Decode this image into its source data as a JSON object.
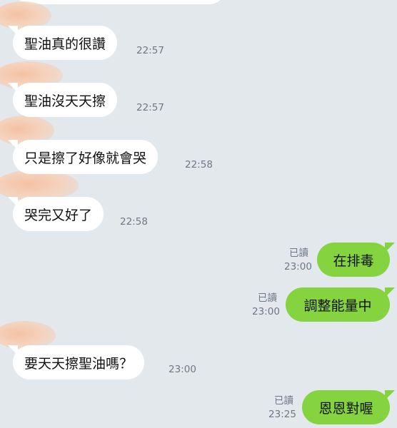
{
  "messages": [
    {
      "text": "聖油真的很讚",
      "time": "22:57"
    },
    {
      "text": "聖油沒天天擦",
      "time": "22:57"
    },
    {
      "text": "只是擦了好像就會哭",
      "time": "22:58"
    },
    {
      "text": "哭完又好了",
      "time": "22:58"
    },
    {
      "text": "在排毒",
      "time": "23:00",
      "read": "已讀"
    },
    {
      "text": "調整能量中",
      "time": "23:00",
      "read": "已讀"
    },
    {
      "text": "要天天擦聖油嗎？",
      "time": "23:00"
    },
    {
      "text": "恩恩對喔",
      "time": "23:25",
      "read": "已讀"
    }
  ],
  "colors": {
    "background": "#e3e8ed",
    "incoming_bubble": "#ffffff",
    "outgoing_bubble": "#84d33f",
    "meta_text": "#6e7885"
  }
}
